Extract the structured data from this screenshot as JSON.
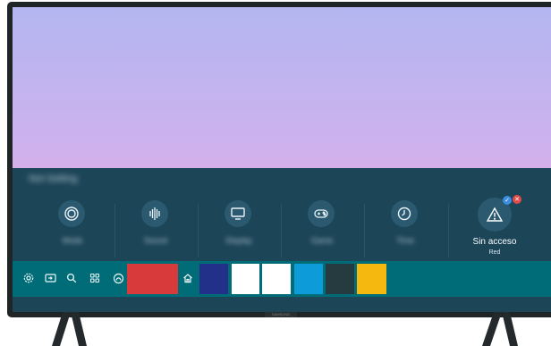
{
  "brand": {
    "logo_text": "SAMSUNG"
  },
  "network_panel": {
    "title": "Not Setting",
    "tiles": [
      {
        "icon": "settings-circle-icon",
        "label": "Mode"
      },
      {
        "icon": "sound-wave-icon",
        "label": "Sound"
      },
      {
        "icon": "tv-icon",
        "label": "Display"
      },
      {
        "icon": "gamepad-icon",
        "label": "Game"
      },
      {
        "icon": "clock-icon",
        "label": "Time"
      }
    ],
    "alert": {
      "icon": "warning-triangle-icon",
      "status_title": "Sin acceso",
      "status_sub": "Red"
    }
  },
  "bottom_bar": {
    "icons": [
      "settings-icon",
      "source-icon",
      "search-icon",
      "apps-icon",
      "ambient-icon",
      "home-icon"
    ],
    "app_colors": [
      "#d83a3b",
      "#22308a",
      "#ffffff",
      "#ffffff",
      "#0d9bd9",
      "#253b40",
      "#f5b80f"
    ]
  }
}
